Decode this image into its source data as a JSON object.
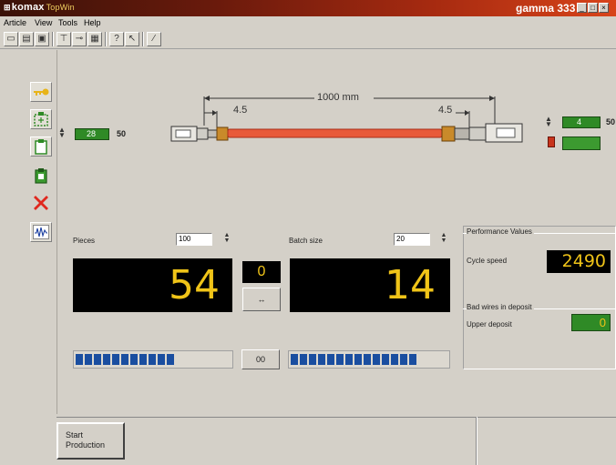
{
  "window": {
    "brand": "komax",
    "brand_sub": "TopWin",
    "machine": "gamma 333"
  },
  "menu": [
    "Article",
    "View",
    "Tools",
    "Help"
  ],
  "wire": {
    "total_length": "1000 mm",
    "strip_left": "4.5",
    "strip_right": "4.5",
    "left_value": "28",
    "left_qty": "50",
    "right_value": "4",
    "right_qty": "50",
    "wire_color": "#e85a3a"
  },
  "production": {
    "pieces_label": "Pieces",
    "pieces_value": "100",
    "batch_label": "Batch size",
    "batch_value": "20",
    "pieces_counter": "54",
    "batch_counter": "14",
    "batch_count_small": "0",
    "arrow_btn": "↔",
    "reset_btn": "00",
    "pieces_progress_blocks": 11,
    "batch_progress_blocks": 14
  },
  "performance": {
    "title": "Performance Values",
    "cycle_label": "Cycle speed",
    "cycle_value": "2490",
    "bad_title": "Bad wires in deposit",
    "upper_label": "Upper deposit",
    "upper_value": "0"
  },
  "bottom": {
    "start_line1": "Start",
    "start_line2": "Production"
  },
  "colors": {
    "accent_yellow": "#f0c418",
    "green": "#2f8a26",
    "progress_blue": "#1a4ea0"
  }
}
